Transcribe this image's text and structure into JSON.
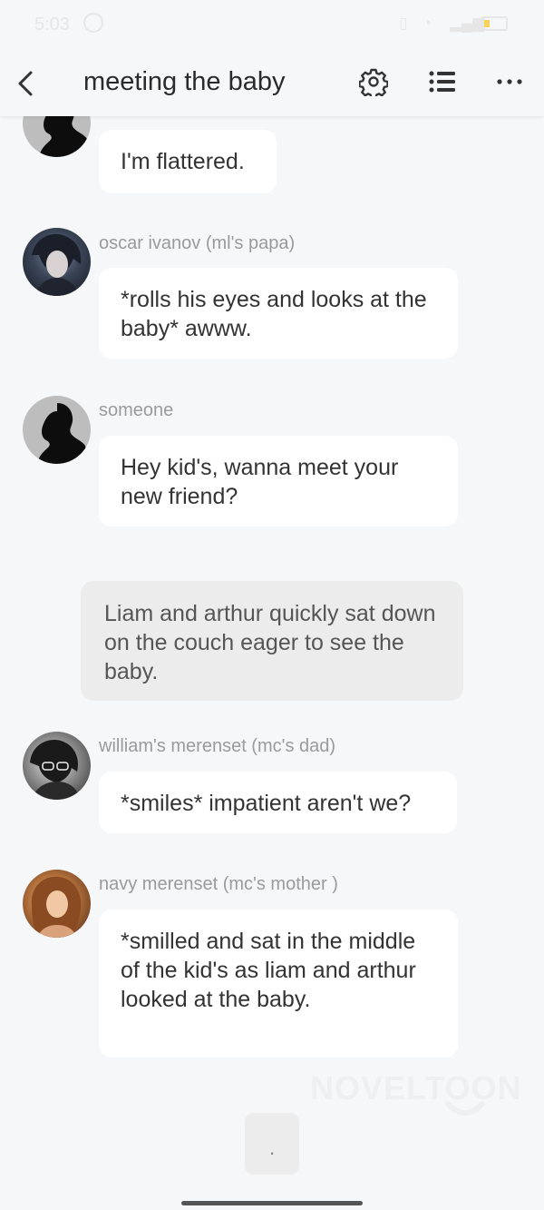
{
  "status_bar": {
    "time": "5:03"
  },
  "header": {
    "title": "meeting the baby"
  },
  "messages": [
    {
      "name": "",
      "text": "I'm flattered."
    },
    {
      "name": "oscar ivanov (ml's papa)",
      "text": "*rolls his eyes and looks at the baby* awww."
    },
    {
      "name": "someone",
      "text": "Hey kid's, wanna meet your new friend?"
    },
    {
      "name": "william's merenset (mc's dad)",
      "text": "*smiles* impatient aren't we?"
    },
    {
      "name": "navy merenset (mc's mother )",
      "text": "*smilled and sat in the middle of the kid's as liam and arthur looked at the baby."
    }
  ],
  "narration": {
    "text": "Liam and arthur quickly sat down on the couch eager to see the baby."
  },
  "watermark": {
    "text": "NOVELTOON"
  },
  "next_button": {
    "label": "."
  },
  "colors": {
    "background": "#f6f7f9",
    "bubble": "#ffffff",
    "narration": "#ececec",
    "name_text": "#9a9a9a"
  }
}
